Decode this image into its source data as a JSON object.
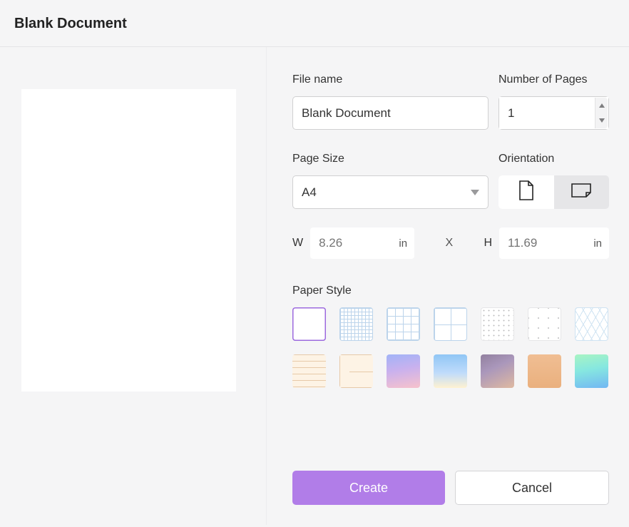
{
  "title": "Blank Document",
  "fields": {
    "file_name_label": "File name",
    "file_name_value": "Blank Document",
    "pages_label": "Number of Pages",
    "pages_value": "1",
    "page_size_label": "Page Size",
    "page_size_value": "A4",
    "orientation_label": "Orientation",
    "width_label": "W",
    "height_label": "H",
    "width_value": "8.26",
    "height_value": "11.69",
    "unit": "in",
    "dim_sep": "X",
    "paper_style_label": "Paper Style"
  },
  "orientation": {
    "selected": "portrait"
  },
  "paper_styles": [
    {
      "id": "blank",
      "selected": true
    },
    {
      "id": "grid-small"
    },
    {
      "id": "grid-medium"
    },
    {
      "id": "grid-large"
    },
    {
      "id": "dots-small"
    },
    {
      "id": "dots-large"
    },
    {
      "id": "isometric"
    },
    {
      "id": "lined-beige"
    },
    {
      "id": "manuscript-beige"
    },
    {
      "id": "gradient-lavender"
    },
    {
      "id": "gradient-sky"
    },
    {
      "id": "gradient-dusk"
    },
    {
      "id": "solid-tan"
    },
    {
      "id": "gradient-mint-blue"
    }
  ],
  "buttons": {
    "create": "Create",
    "cancel": "Cancel"
  },
  "colors": {
    "accent": "#b17de8"
  }
}
